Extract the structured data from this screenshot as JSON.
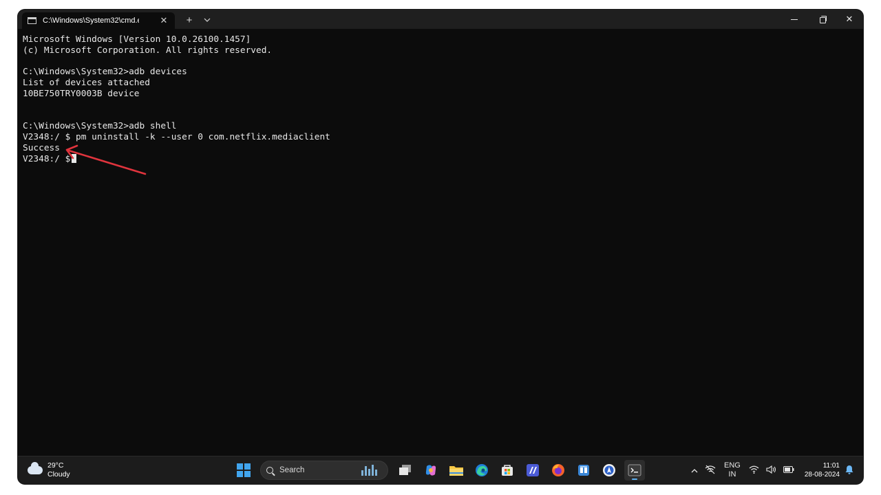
{
  "window": {
    "tab_title": "C:\\Windows\\System32\\cmd.e",
    "tab_close": "✕",
    "new_tab": "+",
    "dropdown": "⌄",
    "close": "✕"
  },
  "terminal": {
    "lines": [
      "Microsoft Windows [Version 10.0.26100.1457]",
      "(c) Microsoft Corporation. All rights reserved.",
      "",
      "C:\\Windows\\System32>adb devices",
      "List of devices attached",
      "10BE750TRY0003B device",
      "",
      "",
      "C:\\Windows\\System32>adb shell",
      "V2348:/ $ pm uninstall -k --user 0 com.netflix.mediaclient",
      "Success",
      "V2348:/ $"
    ],
    "annotation_color": "#e0343d"
  },
  "taskbar": {
    "weather": {
      "temp": "29°C",
      "condition": "Cloudy",
      "icon": "cloud-icon"
    },
    "search_label": "Search",
    "apps": [
      {
        "name": "task-view",
        "color": "#d9d9d9"
      },
      {
        "name": "copilot",
        "color": "#e46fd3"
      },
      {
        "name": "file-explorer",
        "color": "#f6c744"
      },
      {
        "name": "edge",
        "color": "#2fb6d8"
      },
      {
        "name": "microsoft-store",
        "color": "#e8e8e8"
      },
      {
        "name": "app-dark-blue",
        "color": "#4b5bd6"
      },
      {
        "name": "firefox",
        "color": "#f4622b"
      },
      {
        "name": "app-blue",
        "color": "#3a86d6"
      },
      {
        "name": "app-compass",
        "color": "#f0f0f0"
      },
      {
        "name": "terminal",
        "color": "#3a3a3a"
      }
    ],
    "tray": {
      "chevron": "^",
      "language": "ENG",
      "region": "IN",
      "time": "11:01",
      "date": "28-08-2024"
    }
  }
}
